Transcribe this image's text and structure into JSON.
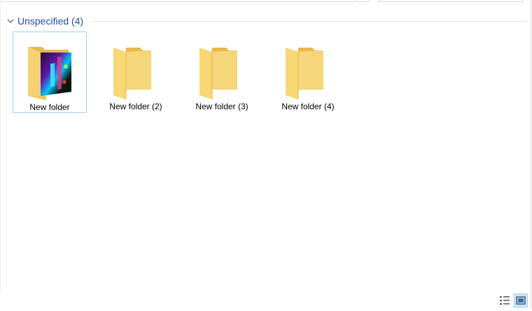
{
  "group": {
    "title": "Unspecified (4)"
  },
  "folders": [
    {
      "label": "New folder",
      "selected": true,
      "has_preview": true
    },
    {
      "label": "New folder (2)",
      "selected": false,
      "has_preview": false
    },
    {
      "label": "New folder (3)",
      "selected": false,
      "has_preview": false
    },
    {
      "label": "New folder (4)",
      "selected": false,
      "has_preview": false
    }
  ],
  "icons": {
    "group_toggle": "chevron-down-icon",
    "folder": "folder-icon",
    "details_view": "details-view-icon",
    "large_icons_view": "large-icons-view-icon"
  },
  "colors": {
    "folder_front": "#f8d775",
    "folder_back": "#e8b94a",
    "group_title": "#1f4e9c",
    "selection_border": "#99d1ff"
  }
}
